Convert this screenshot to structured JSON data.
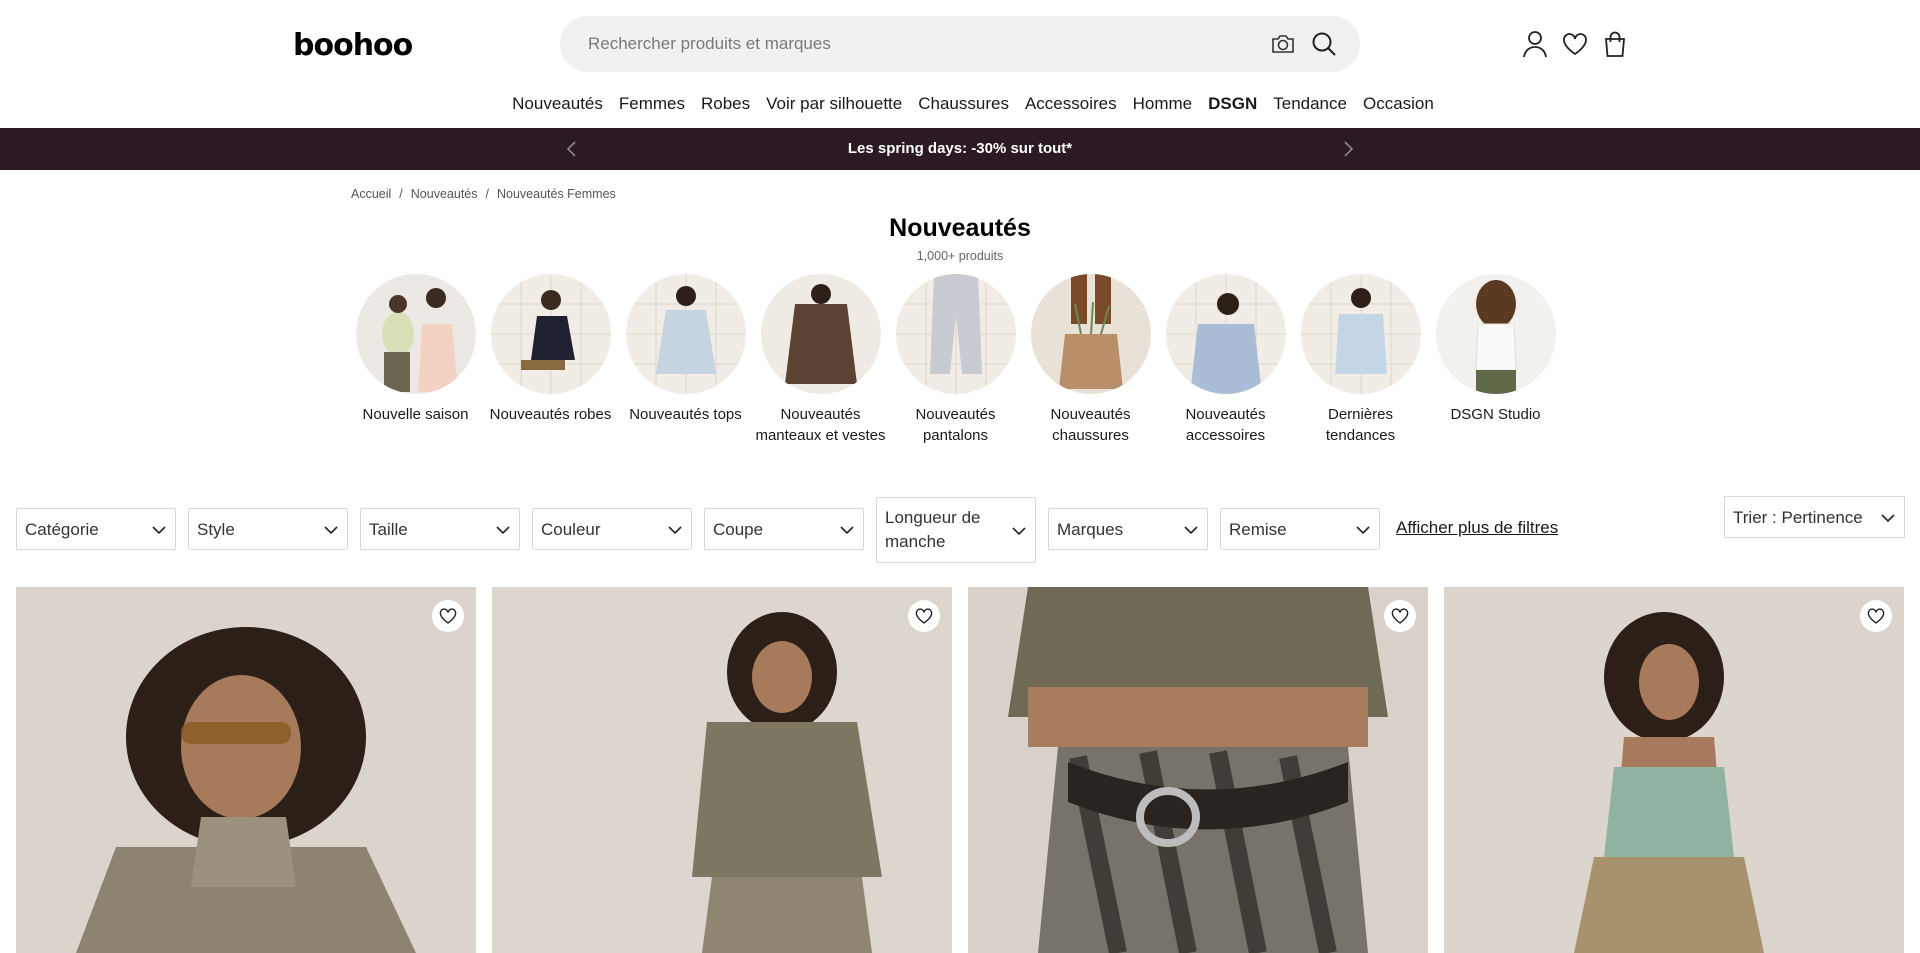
{
  "header": {
    "logo": "boohoo",
    "search_placeholder": "Rechercher produits et marques",
    "icons": [
      "camera-icon",
      "search-icon",
      "account-icon",
      "heart-icon",
      "bag-icon"
    ]
  },
  "nav": {
    "items": [
      "Nouveautés",
      "Femmes",
      "Robes",
      "Voir par silhouette",
      "Chaussures",
      "Accessoires",
      "Homme",
      "DSGN",
      "Tendance",
      "Occasion"
    ]
  },
  "promo": {
    "text": "Les spring days: -30% sur tout*",
    "background": "#2b1a24"
  },
  "breadcrumb": [
    "Accueil",
    "Nouveautés",
    "Nouveautés Femmes"
  ],
  "page": {
    "title": "Nouveautés",
    "count": "1,000+ produits"
  },
  "categories": [
    {
      "label": "Nouvelle saison"
    },
    {
      "label": "Nouveautés robes"
    },
    {
      "label": "Nouveautés tops"
    },
    {
      "label": "Nouveautés manteaux et vestes"
    },
    {
      "label": "Nouveautés pantalons"
    },
    {
      "label": "Nouveautés chaussures"
    },
    {
      "label": "Nouveautés accessoires"
    },
    {
      "label": "Dernières tendances"
    },
    {
      "label": "DSGN Studio"
    }
  ],
  "filters": [
    "Catégorie",
    "Style",
    "Taille",
    "Couleur",
    "Coupe",
    "Longueur de manche",
    "Marques",
    "Remise"
  ],
  "more_filters": "Afficher plus de filtres",
  "sort": "Trier : Pertinence"
}
